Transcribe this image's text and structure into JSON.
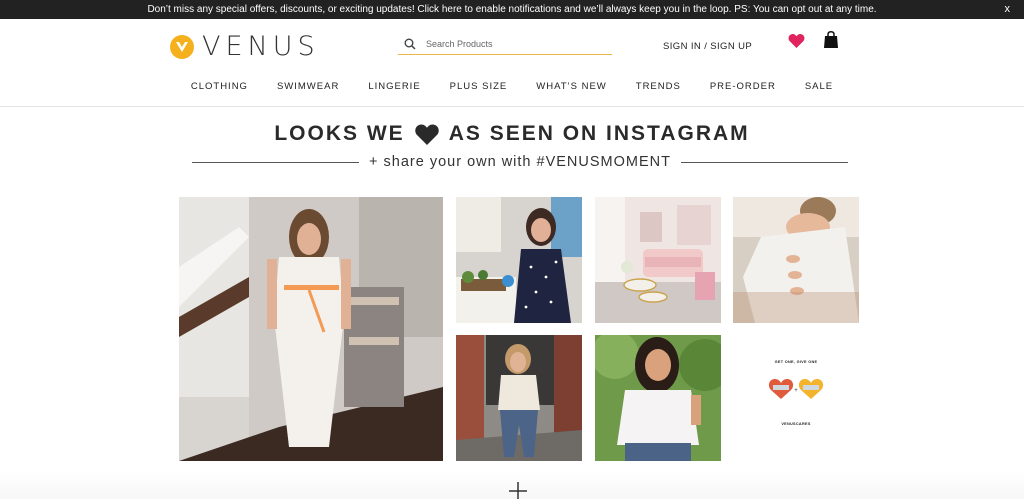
{
  "promo_bar": {
    "message": "Don’t miss any special offers, discounts, or exciting updates! Click here to enable notifications and we’ll always keep you in the loop. PS: You can opt out at any time.",
    "close_label": "x"
  },
  "header": {
    "brand": "VENUS",
    "search_placeholder": "Search Products",
    "signin_label": "SIGN IN / SIGN UP",
    "wishlist_icon": "heart-icon",
    "bag_icon": "shopping-bag-icon"
  },
  "nav": {
    "items": [
      {
        "label": "CLOTHING"
      },
      {
        "label": "SWIMWEAR"
      },
      {
        "label": "LINGERIE"
      },
      {
        "label": "PLUS SIZE"
      },
      {
        "label": "WHAT’S NEW"
      },
      {
        "label": "TRENDS"
      },
      {
        "label": "PRE-ORDER"
      },
      {
        "label": "SALE"
      }
    ]
  },
  "gallery": {
    "title_left": "LOOKS WE",
    "title_right": "AS SEEN ON INSTAGRAM",
    "subtitle": "+ share your own with #VENUSMOMENT",
    "promo_tile_top": "GET ONE, GIVE ONE",
    "promo_tile_bottom": "VENUSCARES"
  },
  "colors": {
    "accent_yellow": "#f5b01e",
    "heart_pink": "#e0245e",
    "promo_bar_bg": "#222222"
  }
}
